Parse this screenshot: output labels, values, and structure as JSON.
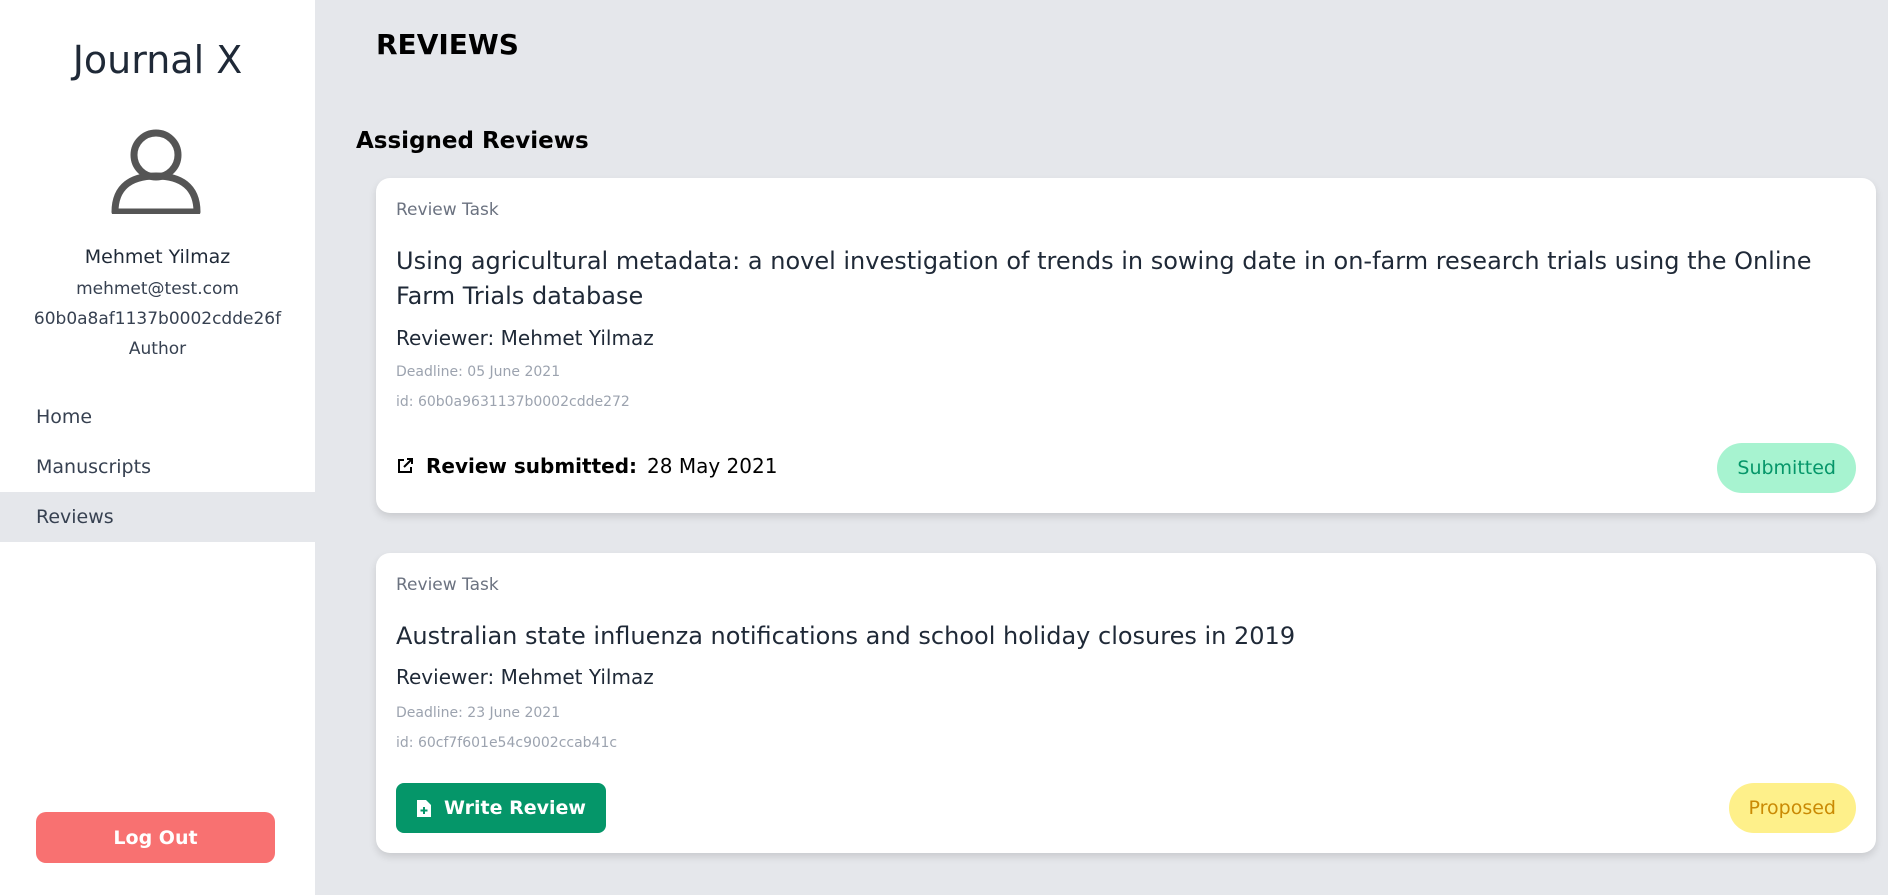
{
  "sidebar": {
    "brand": "Journal X",
    "user": {
      "name": "Mehmet Yilmaz",
      "email": "mehmet@test.com",
      "id": "60b0a8af1137b0002cdde26f",
      "role": "Author"
    },
    "nav": [
      {
        "label": "Home",
        "active": false
      },
      {
        "label": "Manuscripts",
        "active": false
      },
      {
        "label": "Reviews",
        "active": true
      }
    ],
    "logout_label": "Log Out"
  },
  "main": {
    "page_title": "REVIEWS",
    "section_title": "Assigned Reviews",
    "reviews": [
      {
        "label": "Review Task",
        "title": "Using agricultural metadata: a novel investigation of trends in sowing date in on-farm research trials using the Online Farm Trials database",
        "reviewer": "Reviewer: Mehmet Yilmaz",
        "deadline": "Deadline: 05 June 2021",
        "id": "id: 60b0a9631137b0002cdde272",
        "submitted_label": "Review submitted:",
        "submitted_date": "28 May 2021",
        "status": "Submitted"
      },
      {
        "label": "Review Task",
        "title": "Australian state influenza notifications and school holiday closures in 2019",
        "reviewer": "Reviewer: Mehmet Yilmaz",
        "deadline": "Deadline: 23 June 2021",
        "id": "id: 60cf7f601e54c9002ccab41c",
        "action_label": "Write Review",
        "status": "Proposed"
      }
    ]
  },
  "colors": {
    "sidebar_bg": "#ffffff",
    "main_bg": "#e5e7eb",
    "logout": "#f87171",
    "primary_action": "#059669",
    "badge_submitted_bg": "#a7f3d0",
    "badge_submitted_text": "#059669",
    "badge_proposed_bg": "#fef08a",
    "badge_proposed_text": "#ca8a04"
  },
  "icons": [
    "user-avatar-icon",
    "external-link-icon",
    "document-plus-icon"
  ]
}
